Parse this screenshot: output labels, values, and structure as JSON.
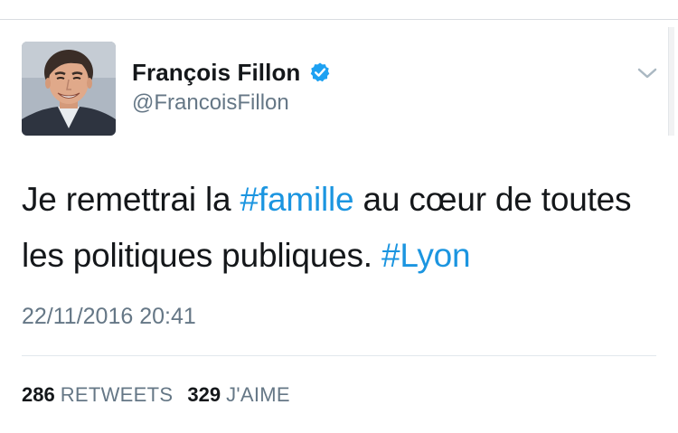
{
  "author": {
    "display_name": "François Fillon",
    "handle": "@FrancoisFillon",
    "verified_icon": "verified-badge-icon",
    "avatar_icon": "profile-photo"
  },
  "tweet": {
    "segments": [
      {
        "text": "Je remettrai la ",
        "type": "text"
      },
      {
        "text": "#famille",
        "type": "hashtag"
      },
      {
        "text": " au cœur de toutes les politiques publiques. ",
        "type": "text"
      },
      {
        "text": "#Lyon",
        "type": "hashtag"
      }
    ],
    "timestamp": "22/11/2016 20:41"
  },
  "stats": {
    "retweets_count": "286",
    "retweets_label": "RETWEETS",
    "likes_count": "329",
    "likes_label": "J'AIME"
  },
  "menu": {
    "icon": "chevron-down-icon"
  },
  "colors": {
    "hashtag": "#1b95e0",
    "verified": "#1da1f2",
    "secondary_text": "#657786",
    "primary_text": "#14171a"
  }
}
